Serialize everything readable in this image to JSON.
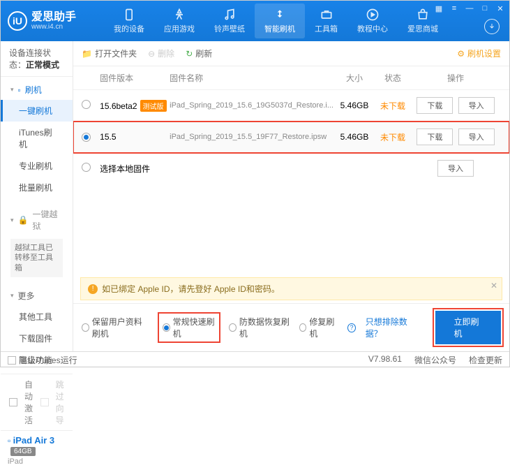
{
  "brand": {
    "name": "爱思助手",
    "url": "www.i4.cn",
    "logo_letter": "iU"
  },
  "nav": [
    {
      "label": "我的设备"
    },
    {
      "label": "应用游戏"
    },
    {
      "label": "铃声壁纸"
    },
    {
      "label": "智能刷机"
    },
    {
      "label": "工具箱"
    },
    {
      "label": "教程中心"
    },
    {
      "label": "爱思商城"
    }
  ],
  "conn": {
    "label": "设备连接状态：",
    "value": "正常模式"
  },
  "side": {
    "flash": {
      "head": "刷机",
      "items": [
        "一键刷机",
        "iTunes刷机",
        "专业刷机",
        "批量刷机"
      ]
    },
    "jailbreak": {
      "head": "一键越狱",
      "note": "越狱工具已转移至工具箱"
    },
    "more": {
      "head": "更多",
      "items": [
        "其他工具",
        "下载固件",
        "高级功能"
      ]
    }
  },
  "side_bottom": {
    "auto_activate": "自动激活",
    "skip_guide": "跳过向导"
  },
  "device": {
    "name": "iPad Air 3",
    "storage": "64GB",
    "type": "iPad"
  },
  "toolbar": {
    "open": "打开文件夹",
    "delete": "删除",
    "refresh": "刷新",
    "settings": "刷机设置"
  },
  "columns": {
    "ver": "固件版本",
    "name": "固件名称",
    "size": "大小",
    "status": "状态",
    "action": "操作"
  },
  "rows": [
    {
      "ver": "15.6beta2",
      "beta": "测试版",
      "name": "iPad_Spring_2019_15.6_19G5037d_Restore.i...",
      "size": "5.46GB",
      "status": "未下载",
      "selected": false
    },
    {
      "ver": "15.5",
      "beta": "",
      "name": "iPad_Spring_2019_15.5_19F77_Restore.ipsw",
      "size": "5.46GB",
      "status": "未下载",
      "selected": true
    }
  ],
  "local_row": "选择本地固件",
  "btns": {
    "download": "下载",
    "import": "导入"
  },
  "notice": "如已绑定 Apple ID，请先登好 Apple ID和密码。",
  "options": {
    "keep": "保留用户资料刷机",
    "fast": "常规快速刷机",
    "recover": "防数据恢复刷机",
    "repair": "修复刷机",
    "exclude": "只想排除数据？"
  },
  "flash_btn": "立即刷机",
  "status": {
    "block_itunes": "阻止iTunes运行",
    "version": "V7.98.61",
    "wechat": "微信公众号",
    "check_update": "检查更新"
  }
}
